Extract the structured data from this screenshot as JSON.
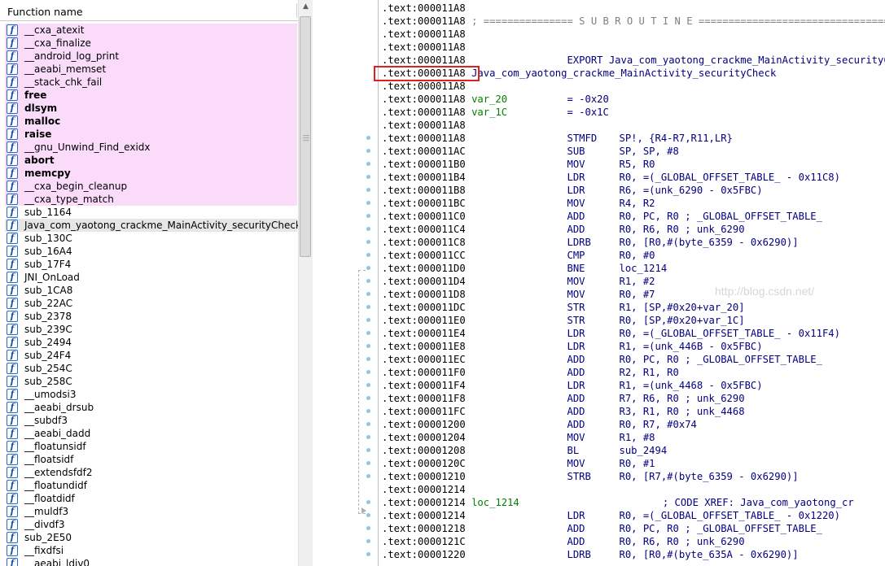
{
  "function_panel": {
    "header": "Function name",
    "functions": [
      {
        "name": "__cxa_atexit",
        "style": "lib"
      },
      {
        "name": "__cxa_finalize",
        "style": "lib"
      },
      {
        "name": "__android_log_print",
        "style": "lib"
      },
      {
        "name": "__aeabi_memset",
        "style": "lib"
      },
      {
        "name": "__stack_chk_fail",
        "style": "lib"
      },
      {
        "name": "free",
        "style": "lib-bold"
      },
      {
        "name": "dlsym",
        "style": "lib-bold"
      },
      {
        "name": "malloc",
        "style": "lib-bold"
      },
      {
        "name": "raise",
        "style": "lib-bold"
      },
      {
        "name": "__gnu_Unwind_Find_exidx",
        "style": "lib"
      },
      {
        "name": "abort",
        "style": "lib-bold"
      },
      {
        "name": "memcpy",
        "style": "lib-bold"
      },
      {
        "name": "__cxa_begin_cleanup",
        "style": "lib"
      },
      {
        "name": "__cxa_type_match",
        "style": "lib"
      },
      {
        "name": "sub_1164",
        "style": "normal"
      },
      {
        "name": "Java_com_yaotong_crackme_MainActivity_securityCheck",
        "style": "selected"
      },
      {
        "name": "sub_130C",
        "style": "normal"
      },
      {
        "name": "sub_16A4",
        "style": "normal"
      },
      {
        "name": "sub_17F4",
        "style": "normal"
      },
      {
        "name": "JNI_OnLoad",
        "style": "normal"
      },
      {
        "name": "sub_1CA8",
        "style": "normal"
      },
      {
        "name": "sub_22AC",
        "style": "normal"
      },
      {
        "name": "sub_2378",
        "style": "normal"
      },
      {
        "name": "sub_239C",
        "style": "normal"
      },
      {
        "name": "sub_2494",
        "style": "normal"
      },
      {
        "name": "sub_24F4",
        "style": "normal"
      },
      {
        "name": "sub_254C",
        "style": "normal"
      },
      {
        "name": "sub_258C",
        "style": "normal"
      },
      {
        "name": "__umodsi3",
        "style": "normal"
      },
      {
        "name": "__aeabi_drsub",
        "style": "normal"
      },
      {
        "name": "__subdf3",
        "style": "normal"
      },
      {
        "name": "__aeabi_dadd",
        "style": "normal"
      },
      {
        "name": "__floatunsidf",
        "style": "normal"
      },
      {
        "name": "__floatsidf",
        "style": "normal"
      },
      {
        "name": "__extendsfdf2",
        "style": "normal"
      },
      {
        "name": "__floatundidf",
        "style": "normal"
      },
      {
        "name": "__floatdidf",
        "style": "normal"
      },
      {
        "name": "__muldf3",
        "style": "normal"
      },
      {
        "name": "__divdf3",
        "style": "normal"
      },
      {
        "name": "sub_2E50",
        "style": "normal"
      },
      {
        "name": "__fixdfsi",
        "style": "normal"
      },
      {
        "name": "__aeabi_ldiv0",
        "style": "normal"
      }
    ]
  },
  "disassembly": {
    "watermark": "http://blog.csdn.net/",
    "highlighted_address": ".text:000011A8",
    "lines": [
      {
        "addr": ".text:000011A8",
        "kind": "blank"
      },
      {
        "addr": ".text:000011A8",
        "kind": "separator",
        "text": " ; =============== S U B R O U T I N E ======================================="
      },
      {
        "addr": ".text:000011A8",
        "kind": "blank"
      },
      {
        "addr": ".text:000011A8",
        "kind": "blank"
      },
      {
        "addr": ".text:000011A8",
        "kind": "export",
        "text": "                 EXPORT Java_com_yaotong_crackme_MainActivity_securityCheck"
      },
      {
        "addr": ".text:000011A8",
        "kind": "label",
        "label": " Java_com_yaotong_crackme_MainActivity_securityCheck"
      },
      {
        "addr": ".text:000011A8",
        "kind": "blank"
      },
      {
        "addr": ".text:000011A8",
        "kind": "var",
        "label": " var_20",
        "text": "          = -0x20"
      },
      {
        "addr": ".text:000011A8",
        "kind": "var",
        "label": " var_1C",
        "text": "          = -0x1C"
      },
      {
        "addr": ".text:000011A8",
        "kind": "blank"
      },
      {
        "addr": ".text:000011A8",
        "kind": "ins",
        "mnem": "STMFD",
        "ops": "SP!, {R4-R7,R11,LR}"
      },
      {
        "addr": ".text:000011AC",
        "kind": "ins",
        "mnem": "SUB",
        "ops": "SP, SP, #8"
      },
      {
        "addr": ".text:000011B0",
        "kind": "ins",
        "mnem": "MOV",
        "ops": "R5, R0"
      },
      {
        "addr": ".text:000011B4",
        "kind": "ins",
        "mnem": "LDR",
        "ops": "R0, =(_GLOBAL_OFFSET_TABLE_ - 0x11C8)"
      },
      {
        "addr": ".text:000011B8",
        "kind": "ins",
        "mnem": "LDR",
        "ops": "R6, =(unk_6290 - 0x5FBC)"
      },
      {
        "addr": ".text:000011BC",
        "kind": "ins",
        "mnem": "MOV",
        "ops": "R4, R2"
      },
      {
        "addr": ".text:000011C0",
        "kind": "ins",
        "mnem": "ADD",
        "ops": "R0, PC, R0 ; _GLOBAL_OFFSET_TABLE_"
      },
      {
        "addr": ".text:000011C4",
        "kind": "ins",
        "mnem": "ADD",
        "ops": "R0, R6, R0 ; unk_6290"
      },
      {
        "addr": ".text:000011C8",
        "kind": "ins",
        "mnem": "LDRB",
        "ops": "R0, [R0,#(byte_6359 - 0x6290)]"
      },
      {
        "addr": ".text:000011CC",
        "kind": "ins",
        "mnem": "CMP",
        "ops": "R0, #0"
      },
      {
        "addr": ".text:000011D0",
        "kind": "ins",
        "mnem": "BNE",
        "ops": "loc_1214"
      },
      {
        "addr": ".text:000011D4",
        "kind": "ins",
        "mnem": "MOV",
        "ops": "R1, #2"
      },
      {
        "addr": ".text:000011D8",
        "kind": "ins",
        "mnem": "MOV",
        "ops": "R0, #7"
      },
      {
        "addr": ".text:000011DC",
        "kind": "ins",
        "mnem": "STR",
        "ops": "R1, [SP,#0x20+var_20]"
      },
      {
        "addr": ".text:000011E0",
        "kind": "ins",
        "mnem": "STR",
        "ops": "R0, [SP,#0x20+var_1C]"
      },
      {
        "addr": ".text:000011E4",
        "kind": "ins",
        "mnem": "LDR",
        "ops": "R0, =(_GLOBAL_OFFSET_TABLE_ - 0x11F4)"
      },
      {
        "addr": ".text:000011E8",
        "kind": "ins",
        "mnem": "LDR",
        "ops": "R1, =(unk_446B - 0x5FBC)"
      },
      {
        "addr": ".text:000011EC",
        "kind": "ins",
        "mnem": "ADD",
        "ops": "R0, PC, R0 ; _GLOBAL_OFFSET_TABLE_"
      },
      {
        "addr": ".text:000011F0",
        "kind": "ins",
        "mnem": "ADD",
        "ops": "R2, R1, R0"
      },
      {
        "addr": ".text:000011F4",
        "kind": "ins",
        "mnem": "LDR",
        "ops": "R1, =(unk_4468 - 0x5FBC)"
      },
      {
        "addr": ".text:000011F8",
        "kind": "ins",
        "mnem": "ADD",
        "ops": "R7, R6, R0 ; unk_6290"
      },
      {
        "addr": ".text:000011FC",
        "kind": "ins",
        "mnem": "ADD",
        "ops": "R3, R1, R0 ; unk_4468"
      },
      {
        "addr": ".text:00001200",
        "kind": "ins",
        "mnem": "ADD",
        "ops": "R0, R7, #0x74"
      },
      {
        "addr": ".text:00001204",
        "kind": "ins",
        "mnem": "MOV",
        "ops": "R1, #8"
      },
      {
        "addr": ".text:00001208",
        "kind": "ins",
        "mnem": "BL",
        "ops": "sub_2494"
      },
      {
        "addr": ".text:0000120C",
        "kind": "ins",
        "mnem": "MOV",
        "ops": "R0, #1"
      },
      {
        "addr": ".text:00001210",
        "kind": "ins",
        "mnem": "STRB",
        "ops": "R0, [R7,#(byte_6359 - 0x6290)]"
      },
      {
        "addr": ".text:00001214",
        "kind": "blank"
      },
      {
        "addr": ".text:00001214",
        "kind": "loc",
        "label": " loc_1214",
        "text": "                        ; CODE XREF: Java_com_yaotong_cr"
      },
      {
        "addr": ".text:00001214",
        "kind": "ins",
        "mnem": "LDR",
        "ops": "R0, =(_GLOBAL_OFFSET_TABLE_ - 0x1220)"
      },
      {
        "addr": ".text:00001218",
        "kind": "ins",
        "mnem": "ADD",
        "ops": "R0, PC, R0 ; _GLOBAL_OFFSET_TABLE_"
      },
      {
        "addr": ".text:0000121C",
        "kind": "ins",
        "mnem": "ADD",
        "ops": "R0, R6, R0 ; unk_6290"
      },
      {
        "addr": ".text:00001220",
        "kind": "ins",
        "mnem": "LDRB",
        "ops": "R0, [R0,#(byte_635A - 0x6290)]"
      }
    ]
  }
}
